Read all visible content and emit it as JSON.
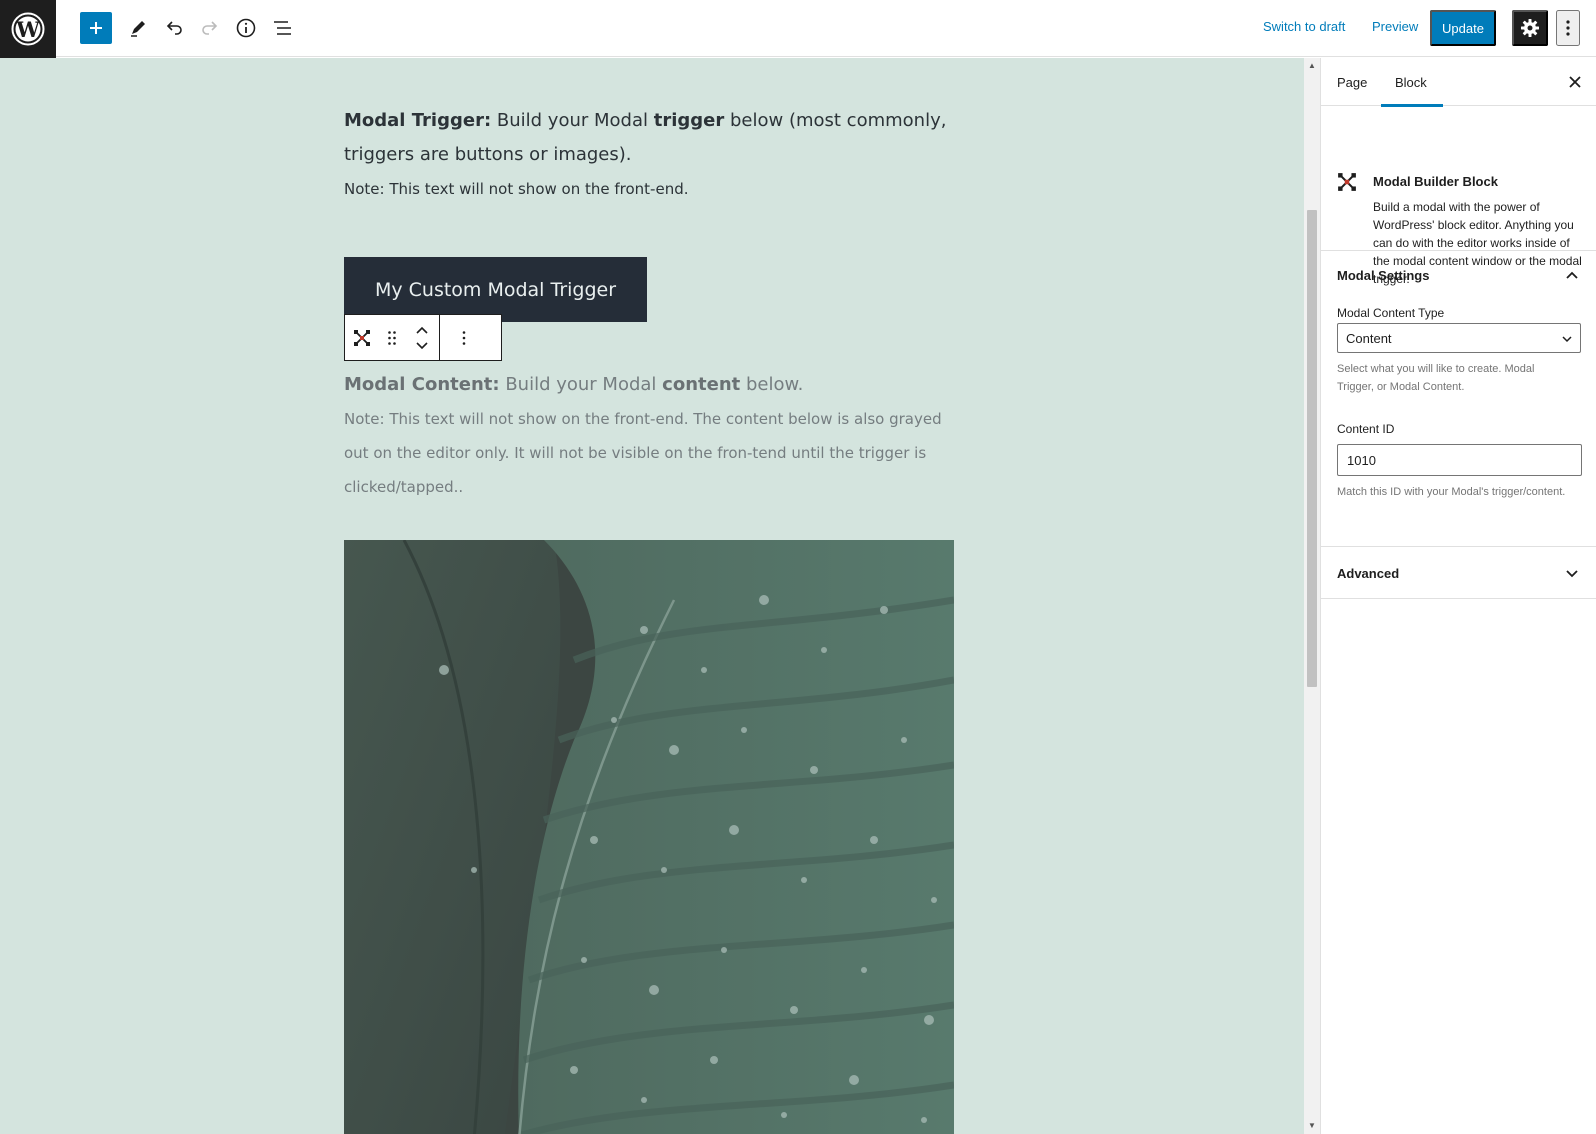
{
  "toolbar": {
    "switch_to_draft": "Switch to draft",
    "preview": "Preview",
    "update": "Update"
  },
  "editor": {
    "trigger_intro_bold": "Modal Trigger:",
    "trigger_intro_1": "Build your Modal",
    "trigger_intro_bold2": "trigger",
    "trigger_intro_2": "below (most commonly, triggers are buttons or images).",
    "trigger_note": "Note: This text will not show on the front-end.",
    "trigger_button": "My Custom Modal Trigger",
    "content_intro_bold": "Modal Content:",
    "content_intro_1": "Build your Modal",
    "content_intro_bold2": "content",
    "content_intro_2": "below.",
    "content_note": "Note: This text will not show on the front-end. The content below is also grayed out on the editor only. It will not be visible on the fron-tend until the trigger is clicked/tapped.."
  },
  "sidebar": {
    "tabs": [
      {
        "label": "Page"
      },
      {
        "label": "Block"
      }
    ],
    "block_card": {
      "title": "Modal Builder Block",
      "description": "Build a modal with the power of WordPress' block editor. Anything you can do with the editor works inside of the modal content window or the modal trigger."
    },
    "modal_settings": {
      "title": "Modal Settings",
      "content_type_label": "Modal Content Type",
      "content_type_value": "Content",
      "content_type_help": "Select what you will like to create. Modal Trigger, or Modal Content.",
      "content_id_label": "Content ID",
      "content_id_value": "1010",
      "content_id_help": "Match this ID with your Modal's trigger/content."
    },
    "advanced": {
      "title": "Advanced"
    }
  },
  "colors": {
    "canvas_bg": "#d4e4de",
    "accent": "#007cba",
    "trigger_button_bg": "#252d38",
    "toolbar_dark": "#1e1e1e"
  }
}
